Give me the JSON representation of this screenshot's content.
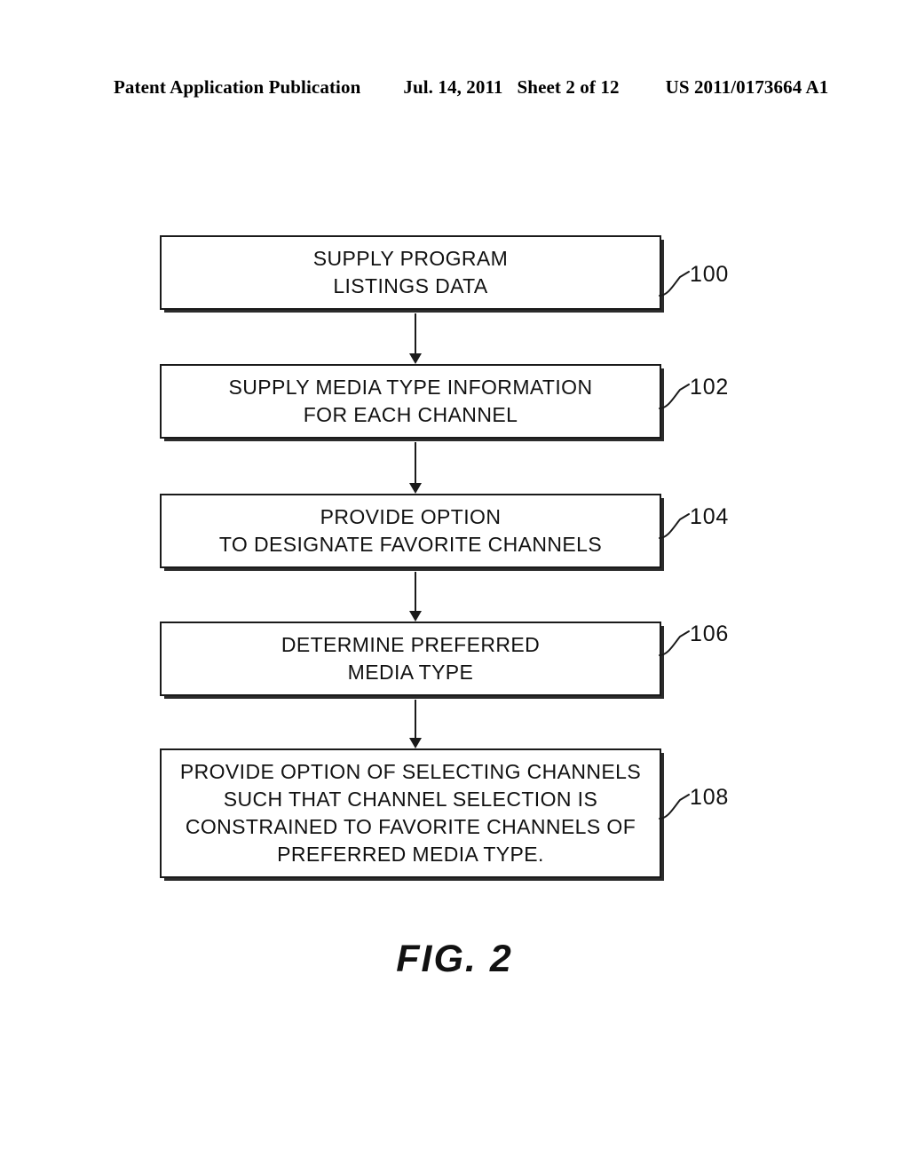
{
  "header": {
    "publication": "Patent Application Publication",
    "date": "Jul. 14, 2011",
    "sheet": "Sheet 2 of 12",
    "publication_number": "US 2011/0173664 A1"
  },
  "figure": {
    "caption": "FIG. 2",
    "type": "flowchart",
    "orientation": "vertical"
  },
  "flowchart": {
    "nodes": [
      {
        "id": "100",
        "label": "SUPPLY PROGRAM\nLISTINGS DATA"
      },
      {
        "id": "102",
        "label": "SUPPLY MEDIA TYPE INFORMATION\nFOR EACH CHANNEL"
      },
      {
        "id": "104",
        "label": "PROVIDE OPTION\nTO DESIGNATE FAVORITE CHANNELS"
      },
      {
        "id": "106",
        "label": "DETERMINE PREFERRED\nMEDIA TYPE"
      },
      {
        "id": "108",
        "label": "PROVIDE OPTION OF SELECTING CHANNELS\nSUCH THAT CHANNEL SELECTION IS\nCONSTRAINED TO FAVORITE CHANNELS OF\nPREFERRED MEDIA TYPE."
      }
    ],
    "connectors": [
      {
        "from": "100",
        "to": "102",
        "arrow": "down"
      },
      {
        "from": "102",
        "to": "104",
        "arrow": "down"
      },
      {
        "from": "104",
        "to": "106",
        "arrow": "down"
      },
      {
        "from": "106",
        "to": "108",
        "arrow": "down"
      }
    ],
    "colors": {
      "line": "#1a1a1a",
      "text": "#111111",
      "background": "#ffffff",
      "shadow": "#2b2b2b"
    }
  }
}
